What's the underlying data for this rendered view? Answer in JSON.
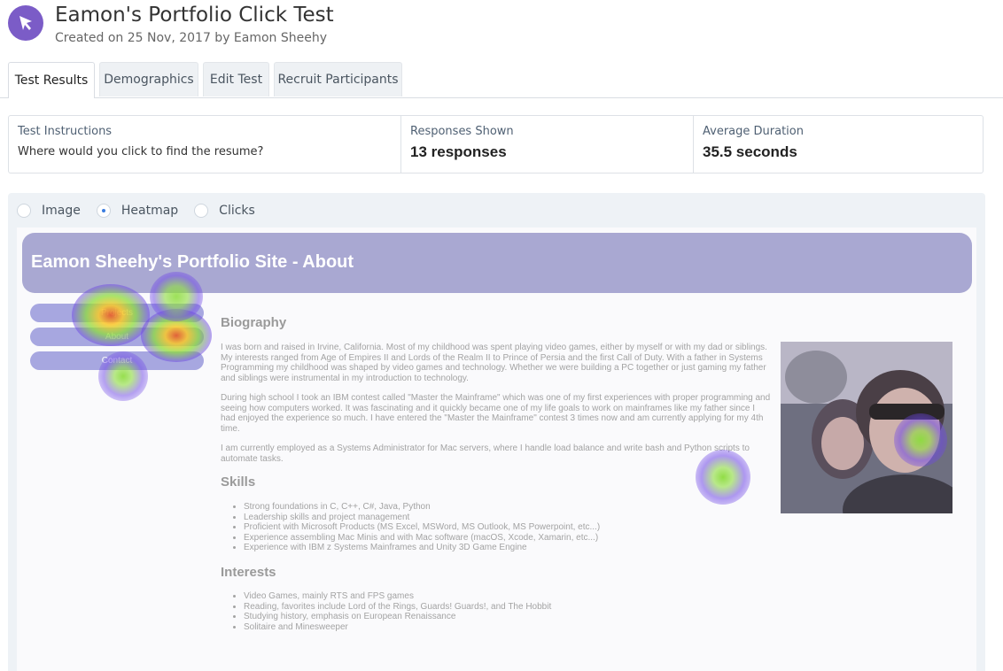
{
  "header": {
    "title": "Eamon's Portfolio Click Test",
    "subtitle": "Created on 25 Nov, 2017 by Eamon Sheehy",
    "logo_icon": "cursor-arrow-icon",
    "brand_color": "#7b5cc7"
  },
  "tabs": [
    {
      "label": "Test Results",
      "active": true
    },
    {
      "label": "Demographics",
      "active": false
    },
    {
      "label": "Edit Test",
      "active": false
    },
    {
      "label": "Recruit Participants",
      "active": false
    }
  ],
  "stats": {
    "instructions": {
      "label": "Test Instructions",
      "value": "Where would you click to find the resume?"
    },
    "responses": {
      "label": "Responses Shown",
      "value": "13 responses"
    },
    "duration": {
      "label": "Average Duration",
      "value": "35.5 seconds"
    }
  },
  "view_modes": {
    "selected": "Heatmap",
    "options": [
      "Image",
      "Heatmap",
      "Clicks"
    ]
  },
  "site": {
    "title": "Eamon Sheehy's Portfolio Site - About",
    "nav": [
      "Projects",
      "About",
      "Contact"
    ],
    "biography_heading": "Biography",
    "biography": [
      "I was born and raised in Irvine, California. Most of my childhood was spent playing video games, either by myself or with my dad or siblings. My interests ranged from Age of Empires II and Lords of the Realm II to Prince of Persia and the first Call of Duty. With a father in Systems Programming my childhood was shaped by video games and technology. Whether we were building a PC together or just gaming my father and siblings were instrumental in my introduction to technology.",
      "During high school I took an IBM contest called \"Master the Mainframe\" which was one of my first experiences with proper programming and seeing how computers worked. It was fascinating and it quickly became one of my life goals to work on mainframes like my father since I had enjoyed the experience so much. I have entered the \"Master the Mainframe\" contest 3 times now and am currently applying for my 4th time.",
      "I am currently employed as a Systems Administrator for Mac servers, where I handle load balance and write bash and Python scripts to automate tasks."
    ],
    "skills_heading": "Skills",
    "skills": [
      "Strong foundations in C, C++, C#, Java, Python",
      "Leadership skills and project management",
      "Proficient with Microsoft Products (MS Excel, MSWord, MS Outlook, MS Powerpoint, etc...)",
      "Experience assembling Mac Minis and with Mac software (macOS, Xcode, Xamarin, etc...)",
      "Experience with IBM z Systems Mainframes and Unity 3D Game Engine"
    ],
    "interests_heading": "Interests",
    "interests": [
      "Video Games, mainly RTS and FPS games",
      "Reading, favorites include Lord of the Rings, Guards! Guards!, and The Hobbit",
      "Studying history, emphasis on European Renaissance",
      "Solitaire and Minesweeper"
    ]
  },
  "colors": {
    "banner": "#a9a8d2",
    "nav_button": "#a7a7e0",
    "panel_bg": "#eef2f6",
    "radio_selected": "#3b7de0"
  }
}
